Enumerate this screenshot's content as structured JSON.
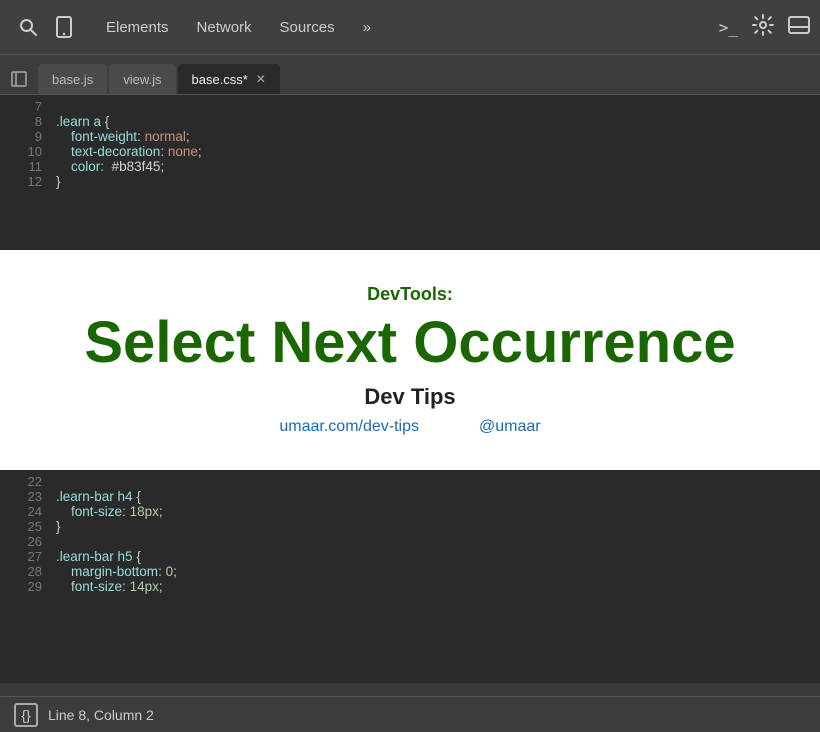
{
  "toolbar": {
    "search_icon": "🔍",
    "mobile_icon": "📱",
    "nav_items": [
      "Elements",
      "Network",
      "Sources"
    ],
    "more_icon": "»",
    "terminal_icon": ">_",
    "gear_icon": "⚙",
    "dock_icon": "⬛"
  },
  "file_tabs": {
    "sidebar_icon": "▶",
    "tabs": [
      {
        "label": "base.js",
        "active": false,
        "closeable": false
      },
      {
        "label": "view.js",
        "active": false,
        "closeable": false
      },
      {
        "label": "base.css*",
        "active": true,
        "closeable": true
      }
    ]
  },
  "code_top": {
    "lines": [
      {
        "num": "7",
        "content": ""
      },
      {
        "num": "8",
        "content": ".learn a {"
      },
      {
        "num": "9",
        "content": "    font-weight: normal;"
      },
      {
        "num": "10",
        "content": "    text-decoration: none;"
      },
      {
        "num": "11",
        "content": "    color: #b83f45;"
      },
      {
        "num": "12",
        "content": "}"
      }
    ]
  },
  "banner": {
    "subtitle": "DevTools:",
    "title": "Select Next Occurrence",
    "brand": "Dev Tips",
    "link1": "umaar.com/dev-tips",
    "link2": "@umaar"
  },
  "code_bottom": {
    "lines": [
      {
        "num": "22",
        "content": ""
      },
      {
        "num": "23",
        "content": ".learn-bar h4 {"
      },
      {
        "num": "24",
        "content": "    font-size: 18px;"
      },
      {
        "num": "25",
        "content": "}"
      },
      {
        "num": "26",
        "content": ""
      },
      {
        "num": "27",
        "content": ".learn-bar h5 {"
      },
      {
        "num": "28",
        "content": "    margin-bottom: 0;"
      },
      {
        "num": "29",
        "content": "    font-size: 14px;"
      }
    ]
  },
  "status_bar": {
    "bracket_label": "{}",
    "position": "Line 8, Column 2"
  }
}
